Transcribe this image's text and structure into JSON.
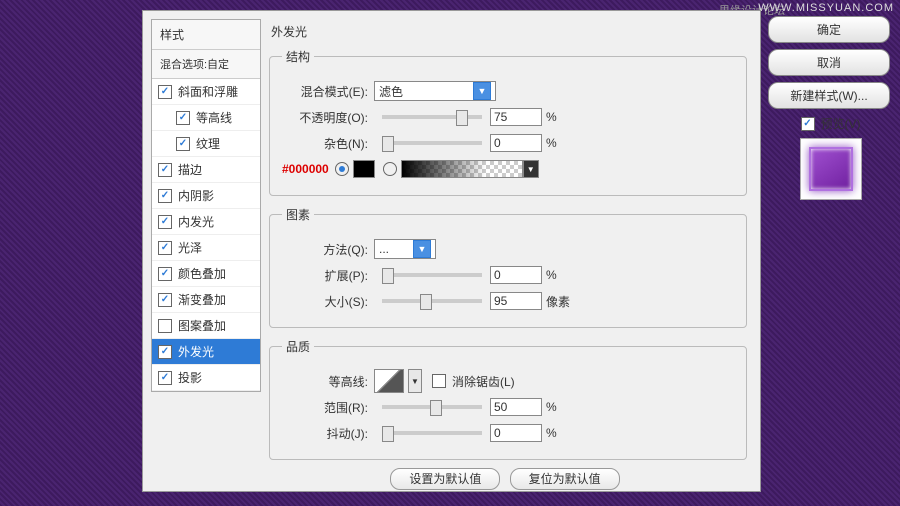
{
  "watermark": {
    "a": "思缘设计论坛",
    "b": "WWW.MISSYUAN.COM"
  },
  "sidebar": {
    "header": "样式",
    "sub": "混合选项:自定",
    "items": [
      {
        "label": "斜面和浮雕",
        "checked": true,
        "indent": false
      },
      {
        "label": "等高线",
        "checked": true,
        "indent": true
      },
      {
        "label": "纹理",
        "checked": true,
        "indent": true
      },
      {
        "label": "描边",
        "checked": true,
        "indent": false
      },
      {
        "label": "内阴影",
        "checked": true,
        "indent": false
      },
      {
        "label": "内发光",
        "checked": true,
        "indent": false
      },
      {
        "label": "光泽",
        "checked": true,
        "indent": false
      },
      {
        "label": "颜色叠加",
        "checked": true,
        "indent": false
      },
      {
        "label": "渐变叠加",
        "checked": true,
        "indent": false
      },
      {
        "label": "图案叠加",
        "checked": false,
        "indent": false
      },
      {
        "label": "外发光",
        "checked": true,
        "indent": false,
        "selected": true
      },
      {
        "label": "投影",
        "checked": true,
        "indent": false
      }
    ]
  },
  "main": {
    "title": "外发光",
    "group1": {
      "legend": "结构",
      "blend": {
        "label": "混合模式(E):",
        "value": "滤色"
      },
      "opacity": {
        "label": "不透明度(O):",
        "value": "75",
        "unit": "%",
        "pos": 74
      },
      "noise": {
        "label": "杂色(N):",
        "value": "0",
        "unit": "%",
        "pos": 0
      },
      "hex": "#000000"
    },
    "group2": {
      "legend": "图素",
      "method": {
        "label": "方法(Q):",
        "value": "..."
      },
      "spread": {
        "label": "扩展(P):",
        "value": "0",
        "unit": "%",
        "pos": 0
      },
      "size": {
        "label": "大小(S):",
        "value": "95",
        "unit": "像素",
        "pos": 38
      }
    },
    "group3": {
      "legend": "品质",
      "contour": {
        "label": "等高线:",
        "antialias": "消除锯齿(L)"
      },
      "range": {
        "label": "范围(R):",
        "value": "50",
        "unit": "%",
        "pos": 48
      },
      "jitter": {
        "label": "抖动(J):",
        "value": "0",
        "unit": "%",
        "pos": 0
      }
    },
    "buttons": {
      "default": "设置为默认值",
      "reset": "复位为默认值"
    }
  },
  "right": {
    "ok": "确定",
    "cancel": "取消",
    "newstyle": "新建样式(W)...",
    "preview": "预览(V)"
  }
}
